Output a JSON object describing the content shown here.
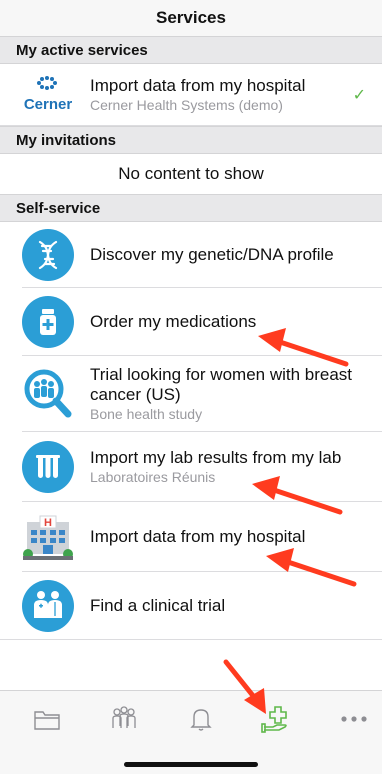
{
  "header": {
    "title": "Services"
  },
  "sections": {
    "active": {
      "label": "My active services"
    },
    "invitations": {
      "label": "My invitations",
      "empty_text": "No content to show"
    },
    "self_service": {
      "label": "Self-service"
    }
  },
  "active_services": [
    {
      "title": "Import data from my hospital",
      "subtitle": "Cerner Health Systems (demo)",
      "logo_text": "Cerner",
      "icon": "cerner-logo",
      "status": "✓"
    }
  ],
  "self_service_items": [
    {
      "title": "Discover my genetic/DNA profile",
      "subtitle": "",
      "icon": "dna-icon"
    },
    {
      "title": "Order my medications",
      "subtitle": "",
      "icon": "medication-bottle-icon"
    },
    {
      "title": "Trial looking for women with breast cancer (US)",
      "subtitle": "Bone health study",
      "icon": "people-magnifier-icon"
    },
    {
      "title": "Import my lab results from my lab",
      "subtitle": "Laboratoires Réunis",
      "icon": "test-tubes-icon"
    },
    {
      "title": "Import data from my hospital",
      "subtitle": "",
      "icon": "hospital-building-icon"
    },
    {
      "title": "Find a clinical trial",
      "subtitle": "",
      "icon": "doctors-icon"
    }
  ],
  "tabbar": {
    "items": [
      {
        "name": "folder-icon",
        "active": false
      },
      {
        "name": "group-icon",
        "active": false
      },
      {
        "name": "bell-icon",
        "active": false
      },
      {
        "name": "services-icon",
        "active": true
      },
      {
        "name": "more-icon",
        "active": false
      }
    ]
  },
  "colors": {
    "accent": "#2b9ed6",
    "active_tab": "#5fb84a",
    "arrow": "#ff3b1f",
    "check": "#5fb84a",
    "cerner_blue": "#1f73b7"
  }
}
